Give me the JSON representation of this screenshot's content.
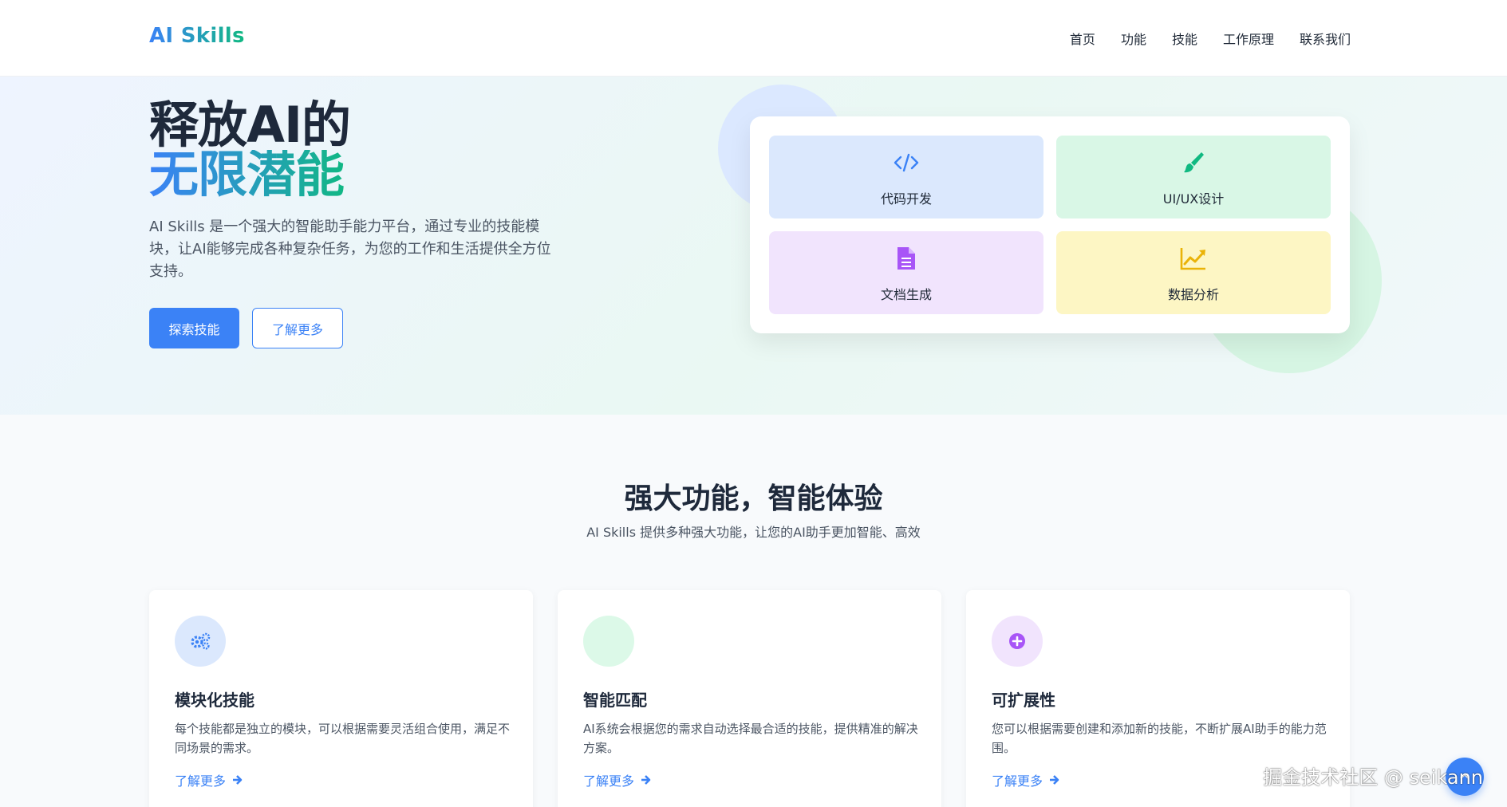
{
  "brand": {
    "logo": "AI Skills"
  },
  "nav": {
    "items": [
      "首页",
      "功能",
      "技能",
      "工作原理",
      "联系我们"
    ]
  },
  "hero": {
    "title_line1": "释放AI的",
    "title_line2": "无限潜能",
    "description": "AI Skills 是一个强大的智能助手能力平台，通过专业的技能模块，让AI能够完成各种复杂任务，为您的工作和生活提供全方位支持。",
    "primary_button": "探索技能",
    "secondary_button": "了解更多"
  },
  "skills": [
    {
      "label": "代码开发",
      "icon": "code-icon",
      "color": "#3b82f6"
    },
    {
      "label": "UI/UX设计",
      "icon": "paintbrush-icon",
      "color": "#10b981"
    },
    {
      "label": "文档生成",
      "icon": "document-icon",
      "color": "#a855f7"
    },
    {
      "label": "数据分析",
      "icon": "chart-line-icon",
      "color": "#eab308"
    }
  ],
  "features": {
    "title": "强大功能，智能体验",
    "subtitle": "AI Skills 提供多种强大功能，让您的AI助手更加智能、高效",
    "cards": [
      {
        "title": "模块化技能",
        "description": "每个技能都是独立的模块，可以根据需要灵活组合使用，满足不同场景的需求。",
        "link": "了解更多",
        "icon": "gears-icon",
        "color": "#3b82f6"
      },
      {
        "title": "智能匹配",
        "description": "AI系统会根据您的需求自动选择最合适的技能，提供精准的解决方案。",
        "link": "了解更多",
        "icon": "match-icon",
        "color": "#10b981"
      },
      {
        "title": "可扩展性",
        "description": "您可以根据需要创建和添加新的技能，不断扩展AI助手的能力范围。",
        "link": "了解更多",
        "icon": "plus-circle-icon",
        "color": "#a855f7"
      }
    ]
  },
  "watermark": "掘金技术社区 @ seikann"
}
